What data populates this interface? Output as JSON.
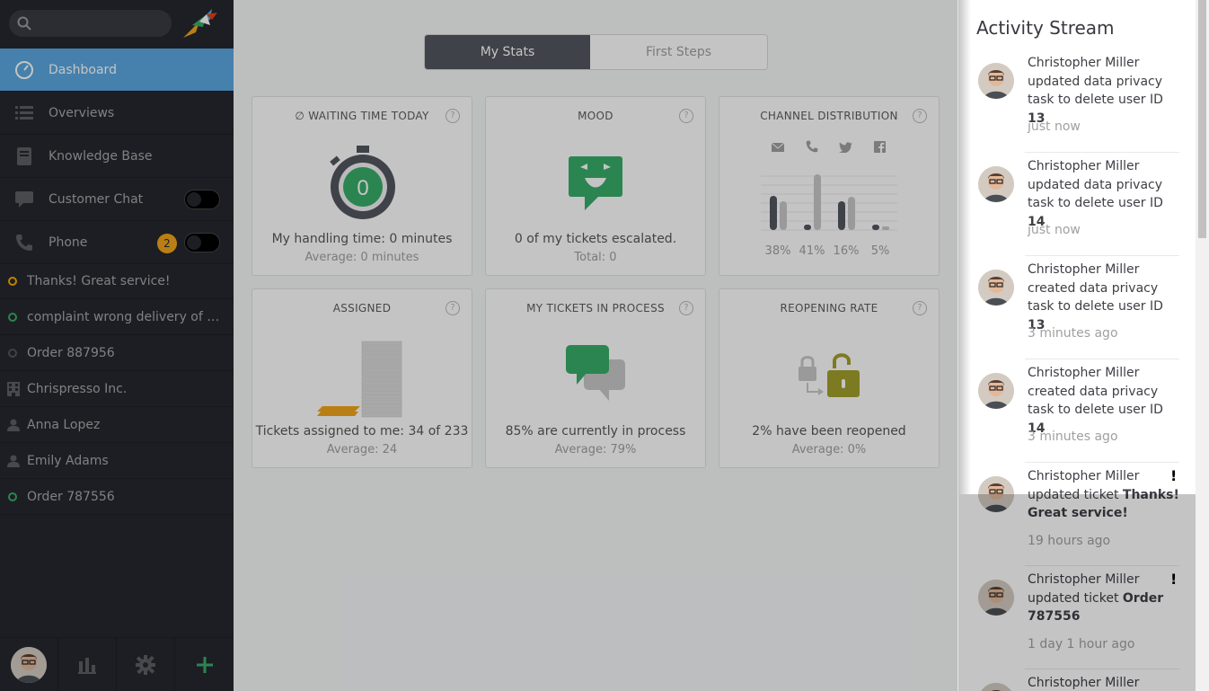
{
  "sidebar": {
    "nav": [
      {
        "label": "Dashboard",
        "icon": "dashboard-icon"
      },
      {
        "label": "Overviews",
        "icon": "list-icon"
      },
      {
        "label": "Knowledge Base",
        "icon": "book-icon"
      },
      {
        "label": "Customer Chat",
        "icon": "chat-icon"
      },
      {
        "label": "Phone",
        "icon": "phone-icon",
        "badge": "2"
      }
    ],
    "tasks": [
      {
        "label": "Thanks! Great service!",
        "icon": "ticket-open-icon"
      },
      {
        "label": "complaint wrong delivery of order",
        "icon": "ticket-new-icon"
      },
      {
        "label": "Order 887956",
        "icon": "ticket-closed-icon"
      },
      {
        "label": "Chrispresso Inc.",
        "icon": "organization-icon"
      },
      {
        "label": "Anna Lopez",
        "icon": "user-icon"
      },
      {
        "label": "Emily Adams",
        "icon": "user-icon"
      },
      {
        "label": "Order 787556",
        "icon": "ticket-new-icon"
      }
    ]
  },
  "tabs": [
    "My Stats",
    "First Steps"
  ],
  "widgets": {
    "waiting": {
      "title": "∅ WAITING TIME TODAY",
      "value": "0",
      "main": "My handling time: 0 minutes",
      "sub": "Average: 0 minutes"
    },
    "mood": {
      "title": "MOOD",
      "main": "0 of my tickets escalated.",
      "sub": "Total: 0"
    },
    "channel": {
      "title": "CHANNEL DISTRIBUTION",
      "percents": [
        "38%",
        "41%",
        "16%",
        "5%"
      ]
    },
    "assigned": {
      "title": "ASSIGNED",
      "main": "Tickets assigned to me: 34 of 233",
      "sub": "Average: 24"
    },
    "inprocess": {
      "title": "MY TICKETS IN PROCESS",
      "main": "85% are currently in process",
      "sub": "Average: 79%"
    },
    "reopening": {
      "title": "REOPENING RATE",
      "main": "2% have been reopened",
      "sub": "Average: 0%"
    }
  },
  "help_glyph": "?",
  "stream": {
    "title": "Activity Stream",
    "items": [
      {
        "pre": "Christopher Miller updated data privacy task to delete user ID ",
        "bold": "13",
        "time": "just now"
      },
      {
        "pre": "Christopher Miller updated data privacy task to delete user ID ",
        "bold": "14",
        "time": "just now"
      },
      {
        "pre": "Christopher Miller created data privacy task to delete user ID ",
        "bold": "13",
        "time": "3 minutes ago"
      },
      {
        "pre": "Christopher Miller created data privacy task to delete user ID ",
        "bold": "14",
        "time": "3 minutes ago"
      },
      {
        "pre": "Christopher Miller updated ticket ",
        "bold": "Thanks! Great service!",
        "time": "19 hours ago",
        "flag": "!"
      },
      {
        "pre": "Christopher Miller updated ticket ",
        "bold": "Order 787556",
        "time": "1 day 1 hour ago",
        "flag": "!"
      },
      {
        "pre": "Christopher Miller started",
        "bold": "",
        "time": ""
      }
    ]
  },
  "colors": {
    "active": "#5aa8e0",
    "green": "#38ad69",
    "orange": "#f2a61a",
    "olive": "#a3a02b",
    "sidebar": "#26272e"
  }
}
